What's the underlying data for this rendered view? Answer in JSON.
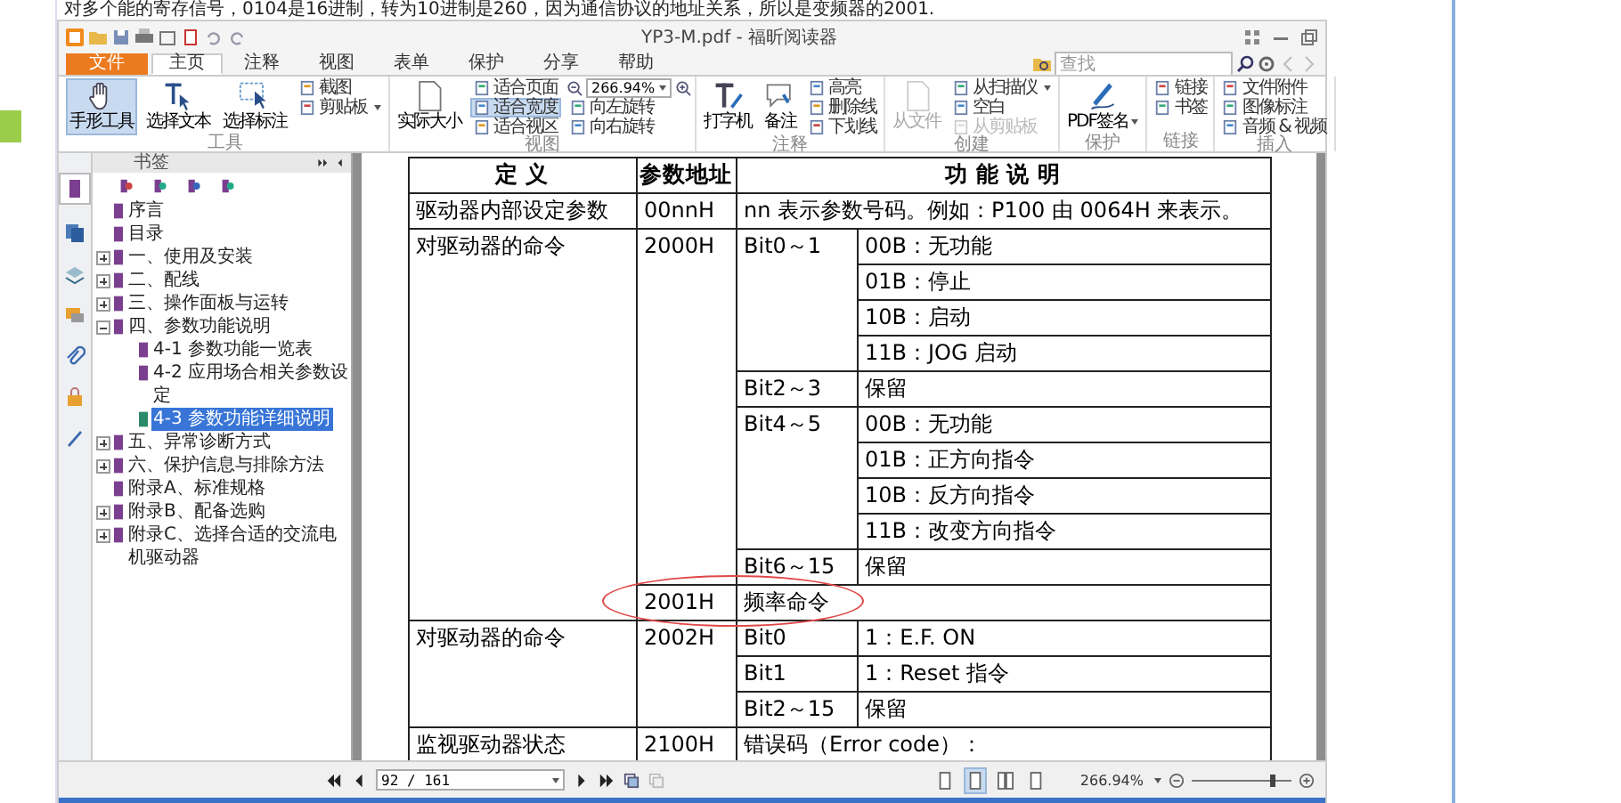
{
  "top_text": "对多个能的寄存信号，0104是16进制，转为10进制是260，因为通信协议的地址关系，所以是变频器的2001.",
  "window": {
    "title": "YP3-M.pdf - 福昕阅读器"
  },
  "menu_tabs": [
    {
      "label": "文件",
      "kind": "file",
      "selected": false
    },
    {
      "label": "主页",
      "kind": "tab",
      "selected": true
    },
    {
      "label": "注释",
      "kind": "tab",
      "selected": false
    },
    {
      "label": "视图",
      "kind": "tab",
      "selected": false
    },
    {
      "label": "表单",
      "kind": "tab",
      "selected": false
    },
    {
      "label": "保护",
      "kind": "tab",
      "selected": false
    },
    {
      "label": "分享",
      "kind": "tab",
      "selected": false
    },
    {
      "label": "帮助",
      "kind": "tab",
      "selected": false
    }
  ],
  "search": {
    "placeholder": "查找"
  },
  "ribbon": [
    {
      "label": "工具",
      "items": [
        {
          "kind": "big",
          "label": "手形工具",
          "selected": true,
          "disabled": false
        },
        {
          "kind": "big",
          "label": "选择文本",
          "selected": false,
          "disabled": false
        },
        {
          "kind": "big",
          "label": "选择标注",
          "selected": false,
          "disabled": false
        },
        {
          "kind": "small",
          "label": "截图",
          "selected": false,
          "disabled": false
        },
        {
          "kind": "small",
          "label": "剪贴板",
          "selected": false,
          "disabled": false,
          "dropdown": true
        }
      ]
    },
    {
      "label": "视图",
      "items": [
        {
          "kind": "big",
          "label": "实际大小",
          "selected": false,
          "disabled": false
        },
        {
          "kind": "small",
          "label": "适合页面",
          "selected": false,
          "disabled": false
        },
        {
          "kind": "small",
          "label": "适合宽度",
          "selected": true,
          "disabled": false
        },
        {
          "kind": "small",
          "label": "适合视区",
          "selected": false,
          "disabled": false
        },
        {
          "kind": "zoom",
          "value": "266.94%"
        },
        {
          "kind": "small",
          "label": "向左旋转",
          "selected": false,
          "disabled": false
        },
        {
          "kind": "small",
          "label": "向右旋转",
          "selected": false,
          "disabled": false
        }
      ]
    },
    {
      "label": "注释",
      "items": [
        {
          "kind": "big",
          "label": "打字机",
          "selected": false,
          "disabled": false
        },
        {
          "kind": "big",
          "label": "备注",
          "selected": false,
          "disabled": false
        },
        {
          "kind": "small",
          "label": "高亮",
          "selected": false,
          "disabled": false
        },
        {
          "kind": "small",
          "label": "删除线",
          "selected": false,
          "disabled": false
        },
        {
          "kind": "small",
          "label": "下划线",
          "selected": false,
          "disabled": false
        }
      ]
    },
    {
      "label": "创建",
      "items": [
        {
          "kind": "big",
          "label": "从文件",
          "selected": false,
          "disabled": true
        },
        {
          "kind": "small",
          "label": "从扫描仪",
          "selected": false,
          "disabled": false,
          "dropdown": true
        },
        {
          "kind": "small",
          "label": "空白",
          "selected": false,
          "disabled": false
        },
        {
          "kind": "small",
          "label": "从剪贴板",
          "selected": false,
          "disabled": true
        }
      ]
    },
    {
      "label": "保护",
      "items": [
        {
          "kind": "big",
          "label": "PDF签名",
          "selected": false,
          "disabled": false,
          "dropdown": true
        }
      ]
    },
    {
      "label": "链接",
      "items": [
        {
          "kind": "small",
          "label": "链接",
          "selected": false,
          "disabled": false
        },
        {
          "kind": "small",
          "label": "书签",
          "selected": false,
          "disabled": false
        }
      ]
    },
    {
      "label": "插入",
      "items": [
        {
          "kind": "small",
          "label": "文件附件",
          "selected": false,
          "disabled": false
        },
        {
          "kind": "small",
          "label": "图像标注",
          "selected": false,
          "disabled": false
        },
        {
          "kind": "small",
          "label": "音频 & 视频",
          "selected": false,
          "disabled": false
        }
      ]
    }
  ],
  "sidebar": {
    "title": "书签",
    "bookmarks": [
      {
        "label": "序言",
        "selected": false
      },
      {
        "label": "目录",
        "selected": false
      },
      {
        "label": "一、使用及安装",
        "selected": false,
        "expanded": false
      },
      {
        "label": "二、配线",
        "selected": false,
        "expanded": false
      },
      {
        "label": "三、操作面板与运转",
        "selected": false,
        "expanded": false
      },
      {
        "label": "四、参数功能说明",
        "selected": false,
        "expanded": true,
        "children": [
          {
            "label": "4-1 参数功能一览表",
            "selected": false
          },
          {
            "label": "4-2 应用场合相关参数设定",
            "selected": false
          },
          {
            "label": "4-3 参数功能详细说明",
            "selected": true
          }
        ]
      },
      {
        "label": "五、异常诊断方式",
        "selected": false,
        "expanded": false
      },
      {
        "label": "六、保护信息与排除方法",
        "selected": false,
        "expanded": false
      },
      {
        "label": "附录A、标准规格",
        "selected": false
      },
      {
        "label": "附录B、配备选购",
        "selected": false,
        "expanded": false
      },
      {
        "label": "附录C、选择合适的交流电机驱动器",
        "selected": false,
        "expanded": false
      }
    ]
  },
  "table": {
    "columns": [
      "定 义",
      "参数地址",
      "功 能 说 明"
    ],
    "groups": [
      {
        "definition": "驱动器内部设定参数",
        "entries": [
          {
            "address": "00nnH",
            "circled": false,
            "description": "nn 表示参数号码。例如：P100 由 0064H 来表示。"
          }
        ]
      },
      {
        "definition": "对驱动器的命令",
        "entries": [
          {
            "address": "2000H",
            "circled": false,
            "bits": [
              {
                "bit": "Bit0～1",
                "values": [
                  "00B：无功能",
                  "01B：停止",
                  "10B：启动",
                  "11B：JOG 启动"
                ]
              },
              {
                "bit": "Bit2～3",
                "values": [
                  "保留"
                ]
              },
              {
                "bit": "Bit4～5",
                "values": [
                  "00B：无功能",
                  "01B：正方向指令",
                  "10B：反方向指令",
                  "11B：改变方向指令"
                ]
              },
              {
                "bit": "Bit6～15",
                "values": [
                  "保留"
                ]
              }
            ]
          },
          {
            "address": "2001H",
            "circled": true,
            "description": "频率命令"
          }
        ]
      },
      {
        "definition": "对驱动器的命令",
        "entries": [
          {
            "address": "2002H",
            "circled": false,
            "bits": [
              {
                "bit": "Bit0",
                "values": [
                  "1：E.F. ON"
                ]
              },
              {
                "bit": "Bit1",
                "values": [
                  "1：Reset 指令"
                ]
              },
              {
                "bit": "Bit2～15",
                "values": [
                  "保留"
                ]
              }
            ]
          }
        ]
      },
      {
        "definition": "监视驱动器状态",
        "entries": [
          {
            "address": "2100H",
            "circled": false,
            "description": "错误码（Error code）："
          }
        ]
      }
    ]
  },
  "status_bar": {
    "page": "92 / 161",
    "view_modes": [
      {
        "selected": false
      },
      {
        "selected": true
      },
      {
        "selected": false
      },
      {
        "selected": false
      }
    ],
    "zoom": "266.94%",
    "zoom_slider": {
      "level": 0.82
    }
  }
}
